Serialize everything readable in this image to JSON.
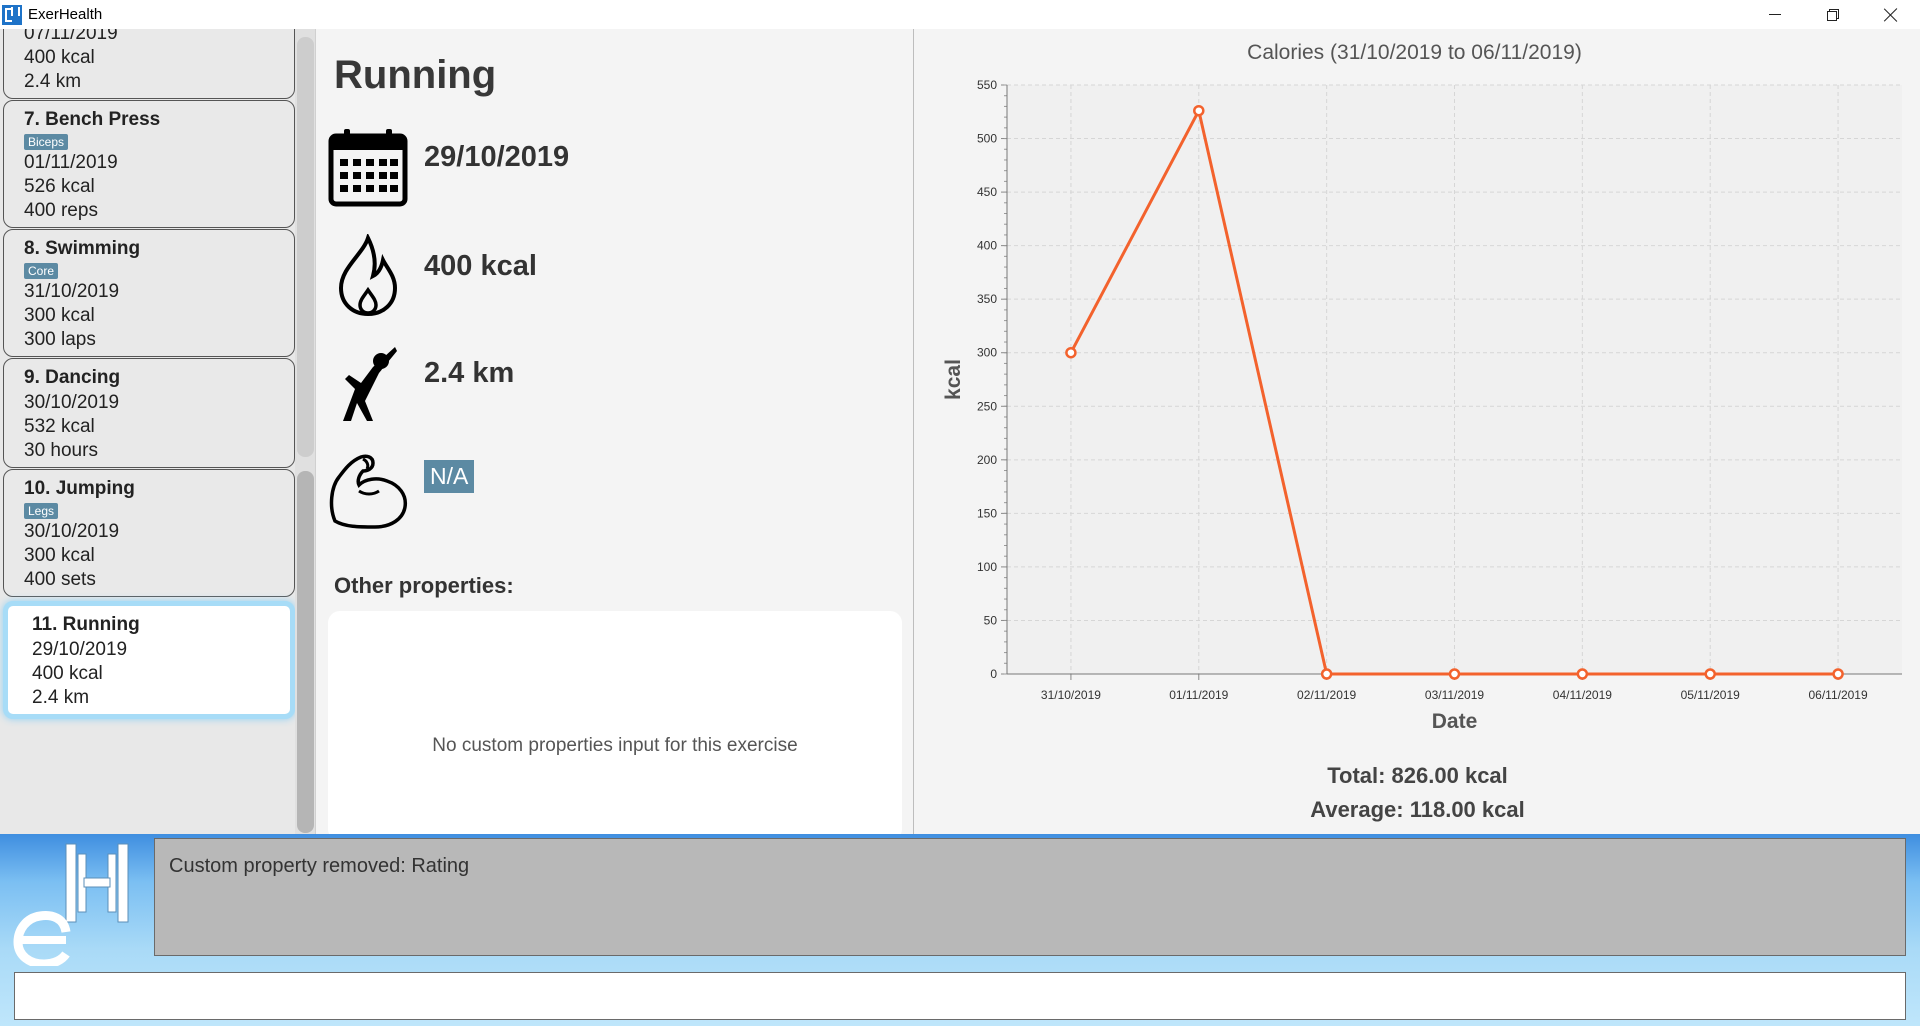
{
  "window": {
    "title": "ExerHealth"
  },
  "list": {
    "cards": [
      {
        "title": "",
        "tag": "",
        "lines": [
          "07/11/2019",
          "400 kcal",
          "2.4 km"
        ]
      },
      {
        "title": "7.  Bench Press",
        "tag": "Biceps",
        "lines": [
          "01/11/2019",
          "526 kcal",
          "400 reps"
        ]
      },
      {
        "title": "8.  Swimming",
        "tag": "Core",
        "lines": [
          "31/10/2019",
          "300 kcal",
          "300 laps"
        ]
      },
      {
        "title": "9.  Dancing",
        "tag": "",
        "lines": [
          "30/10/2019",
          "532 kcal",
          "30 hours"
        ]
      },
      {
        "title": "10.  Jumping",
        "tag": "Legs",
        "lines": [
          "30/10/2019",
          "300 kcal",
          "400 sets"
        ]
      },
      {
        "title": "11.  Running",
        "tag": "",
        "lines": [
          "29/10/2019",
          "400 kcal",
          "2.4 km"
        ],
        "selected": true
      }
    ]
  },
  "detail": {
    "title": "Running",
    "date": "29/10/2019",
    "calories": "400 kcal",
    "quantity": "2.4 km",
    "muscle": "N/A",
    "other_label": "Other properties:",
    "other_empty": "No custom properties input for this exercise",
    "icons": {
      "date": "calendar-icon",
      "calories": "flame-icon",
      "quantity": "stretching-person-icon",
      "muscle": "flexed-bicep-icon"
    }
  },
  "chart_data": {
    "type": "line",
    "title": "Calories (31/10/2019 to 06/11/2019)",
    "xlabel": "Date",
    "ylabel": "kcal",
    "categories": [
      "31/10/2019",
      "01/11/2019",
      "02/11/2019",
      "03/11/2019",
      "04/11/2019",
      "05/11/2019",
      "06/11/2019"
    ],
    "values": [
      300,
      526,
      0,
      0,
      0,
      0,
      0
    ],
    "ylim": [
      0,
      550
    ],
    "yticks": [
      0,
      50,
      100,
      150,
      200,
      250,
      300,
      350,
      400,
      450,
      500,
      550
    ],
    "grid": true,
    "color": "#f3622d"
  },
  "summary": {
    "total": "Total: 826.00 kcal",
    "average": "Average: 118.00 kcal"
  },
  "result": {
    "text": "Custom property removed: Rating"
  },
  "command": {
    "value": "",
    "placeholder": ""
  },
  "colors": {
    "tag": "#5c8aa3",
    "selected_border": "#a7dcf7",
    "line": "#f3622d"
  }
}
